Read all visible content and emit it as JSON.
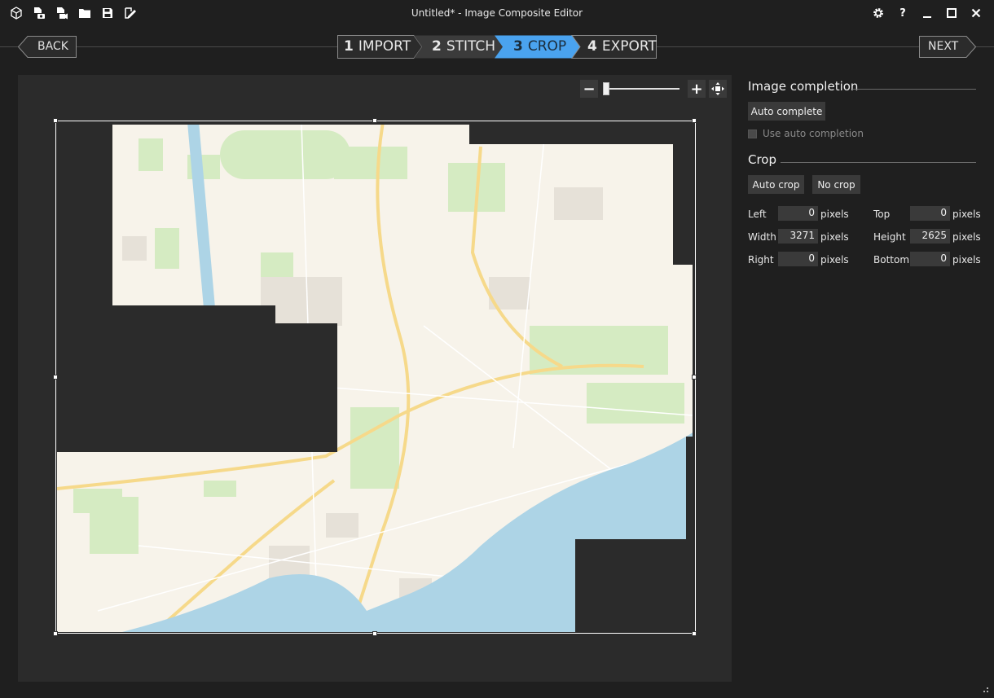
{
  "window": {
    "title": "Untitled* - Image Composite Editor"
  },
  "toolbar": {
    "icons": [
      "new-panorama-icon",
      "new-panorama-from-images-icon",
      "new-panorama-from-video-icon",
      "open-project-icon",
      "save-project-icon",
      "export-icon"
    ]
  },
  "window_controls": {
    "settings_icon": "gear-icon",
    "help": "?",
    "minimize": "minimize-icon",
    "maximize": "maximize-icon",
    "close": "close-icon"
  },
  "nav": {
    "back_label": "BACK",
    "next_label": "NEXT"
  },
  "steps": [
    {
      "number": "1",
      "label": "IMPORT",
      "active": false
    },
    {
      "number": "2",
      "label": "STITCH",
      "active": false
    },
    {
      "number": "3",
      "label": "CROP",
      "active": true
    },
    {
      "number": "4",
      "label": "EXPORT",
      "active": false
    }
  ],
  "zoom": {
    "minus": "−",
    "plus": "+",
    "fit_icon": "fit-to-window-icon",
    "level": 0.03
  },
  "image_completion": {
    "title": "Image completion",
    "auto_complete_label": "Auto complete",
    "use_auto_completion_label": "Use auto completion",
    "use_auto_completion_checked": false
  },
  "crop": {
    "title": "Crop",
    "auto_crop_label": "Auto crop",
    "no_crop_label": "No crop",
    "fields": {
      "left": {
        "label": "Left",
        "value": "0",
        "unit": "pixels"
      },
      "top": {
        "label": "Top",
        "value": "0",
        "unit": "pixels"
      },
      "width": {
        "label": "Width",
        "value": "3271",
        "unit": "pixels"
      },
      "height": {
        "label": "Height",
        "value": "2625",
        "unit": "pixels"
      },
      "right": {
        "label": "Right",
        "value": "0",
        "unit": "pixels"
      },
      "bottom": {
        "label": "Bottom",
        "value": "0",
        "unit": "pixels"
      }
    }
  },
  "colors": {
    "accent": "#4aa3ef",
    "panel_bg": "#1f1f1f",
    "canvas_bg": "#2b2b2b",
    "button_bg": "#3a3a3a",
    "water": "#add4e6",
    "land": "#f7f3ea"
  }
}
